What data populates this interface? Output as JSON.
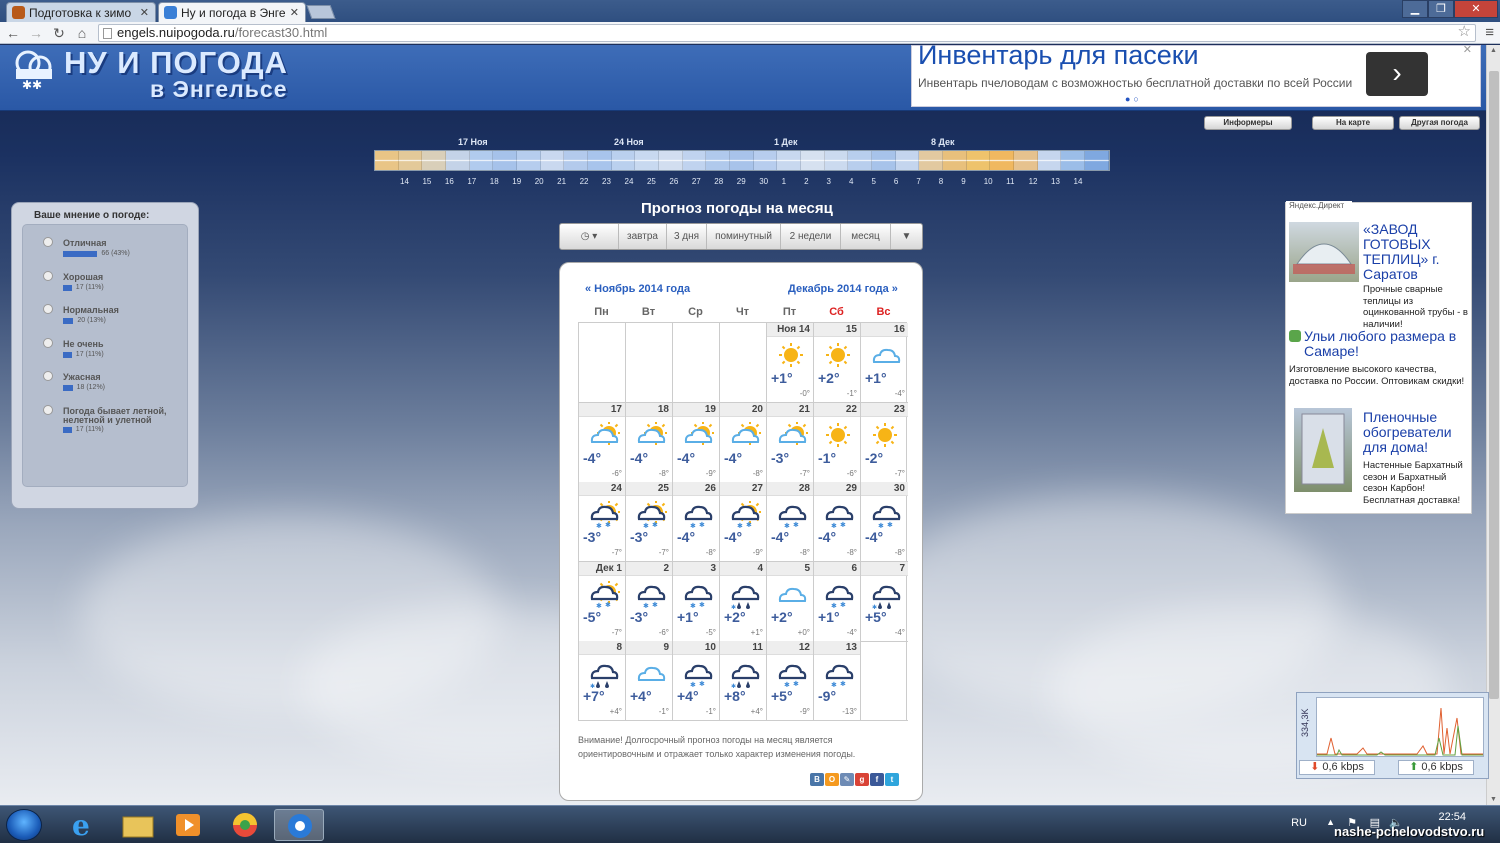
{
  "browser": {
    "tabs": [
      {
        "title": "Подготовка к зимо"
      },
      {
        "title": "Ну и погода в Энге"
      }
    ],
    "url_host": "engels.nuipogoda.ru",
    "url_path": "/forecast30.html"
  },
  "header": {
    "logo_line1": "НУ И ПОГОДА",
    "logo_line2": "в Энгельсе"
  },
  "ad": {
    "title": "Инвентарь для пасеки",
    "subtitle": "Инвентарь пчеловодам с возможностью бесплатной доставки по всей России",
    "dots": "●○"
  },
  "top_buttons": [
    "Информеры",
    "На карте",
    "Другая погода"
  ],
  "timeline": {
    "week_labels": [
      "17 Ноя",
      "24 Ноя",
      "1 Дек",
      "8 Дек"
    ],
    "days": [
      "14",
      "15",
      "16",
      "17",
      "18",
      "19",
      "20",
      "21",
      "22",
      "23",
      "24",
      "25",
      "26",
      "27",
      "28",
      "29",
      "30",
      "1",
      "2",
      "3",
      "4",
      "5",
      "6",
      "7",
      "8",
      "9",
      "10",
      "11",
      "12",
      "13",
      "14"
    ]
  },
  "vote": {
    "title": "Ваше мнение о погоде:",
    "options": [
      {
        "label": "Отличная",
        "count": "66 (43%)",
        "share": 0.43
      },
      {
        "label": "Хорошая",
        "count": "17 (11%)",
        "share": 0.11
      },
      {
        "label": "Нормальная",
        "count": "20 (13%)",
        "share": 0.13
      },
      {
        "label": "Не очень",
        "count": "17 (11%)",
        "share": 0.11
      },
      {
        "label": "Ужасная",
        "count": "18 (12%)",
        "share": 0.12
      },
      {
        "label": "Погода бывает летной, нелетной и улетной",
        "count": "17 (11%)",
        "share": 0.11
      }
    ]
  },
  "forecast": {
    "title": "Прогноз погоды на месяц",
    "tabs": [
      "завтра",
      "3 дня",
      "поминутный",
      "2 недели",
      "месяц"
    ],
    "prev_month": "« Ноябрь 2014 года",
    "next_month": "Декабрь 2014 года »",
    "weekdays": [
      "Пн",
      "Вт",
      "Ср",
      "Чт",
      "Пт",
      "Сб",
      "Вс"
    ],
    "weeks": [
      [
        null,
        null,
        null,
        null,
        {
          "day": "Ноя 14",
          "icon": "sun",
          "t": "+1°",
          "n": "-0°"
        },
        {
          "day": "15",
          "icon": "sun",
          "t": "+2°",
          "n": "-1°"
        },
        {
          "day": "16",
          "icon": "cloud",
          "t": "+1°",
          "n": "-4°"
        }
      ],
      [
        {
          "day": "17",
          "icon": "sun-cloud",
          "t": "-4°",
          "n": "-6°"
        },
        {
          "day": "18",
          "icon": "sun-cloud",
          "t": "-4°",
          "n": "-8°"
        },
        {
          "day": "19",
          "icon": "sun-cloud",
          "t": "-4°",
          "n": "-9°"
        },
        {
          "day": "20",
          "icon": "sun-cloud",
          "t": "-4°",
          "n": "-8°"
        },
        {
          "day": "21",
          "icon": "sun-cloud",
          "t": "-3°",
          "n": "-7°"
        },
        {
          "day": "22",
          "icon": "sun",
          "t": "-1°",
          "n": "-6°"
        },
        {
          "day": "23",
          "icon": "sun",
          "t": "-2°",
          "n": "-7°"
        }
      ],
      [
        {
          "day": "24",
          "icon": "sun-snow",
          "t": "-3°",
          "n": "-7°"
        },
        {
          "day": "25",
          "icon": "sun-snow",
          "t": "-3°",
          "n": "-7°"
        },
        {
          "day": "26",
          "icon": "snow",
          "t": "-4°",
          "n": "-8°"
        },
        {
          "day": "27",
          "icon": "sun-snow",
          "t": "-4°",
          "n": "-9°"
        },
        {
          "day": "28",
          "icon": "snow",
          "t": "-4°",
          "n": "-8°"
        },
        {
          "day": "29",
          "icon": "snow",
          "t": "-4°",
          "n": "-8°"
        },
        {
          "day": "30",
          "icon": "snow",
          "t": "-4°",
          "n": "-8°"
        }
      ],
      [
        {
          "day": "Дек 1",
          "icon": "sun-snow",
          "t": "-5°",
          "n": "-7°"
        },
        {
          "day": "2",
          "icon": "snow",
          "t": "-3°",
          "n": "-6°"
        },
        {
          "day": "3",
          "icon": "snow",
          "t": "+1°",
          "n": "-5°"
        },
        {
          "day": "4",
          "icon": "rain-snow",
          "t": "+2°",
          "n": "+1°"
        },
        {
          "day": "5",
          "icon": "cloud",
          "t": "+2°",
          "n": "+0°"
        },
        {
          "day": "6",
          "icon": "snow",
          "t": "+1°",
          "n": "-4°"
        },
        {
          "day": "7",
          "icon": "rain-snow",
          "t": "+5°",
          "n": "-4°"
        }
      ],
      [
        {
          "day": "8",
          "icon": "rain-snow",
          "t": "+7°",
          "n": "+4°"
        },
        {
          "day": "9",
          "icon": "cloud",
          "t": "+4°",
          "n": "-1°"
        },
        {
          "day": "10",
          "icon": "snow",
          "t": "+4°",
          "n": "-1°"
        },
        {
          "day": "11",
          "icon": "rain-snow",
          "t": "+8°",
          "n": "+4°"
        },
        {
          "day": "12",
          "icon": "snow",
          "t": "+5°",
          "n": "-9°"
        },
        {
          "day": "13",
          "icon": "snow",
          "t": "-9°",
          "n": "-13°"
        },
        null
      ]
    ],
    "warning": "Внимание! Долгосрочный прогноз погоды на месяц является ориентировочным и отражает только характер изменения погоды."
  },
  "direct": {
    "label": "Яндекс.Директ",
    "ads": [
      {
        "title": "«ЗАВОД ГОТОВЫХ ТЕПЛИЦ» г. Саратов",
        "text": "Прочные сварные теплицы из оцинкованной трубы - в наличии!"
      },
      {
        "title": "Ульи любого размера в Самаре!",
        "text": "Изготовление высокого качества, доставка по России. Оптовикам скидки!"
      },
      {
        "title": "Пленочные обогреватели для дома!",
        "text": "Настенные Бархатный сезон и Бархатный сезон Карбон! Бесплатная доставка!"
      }
    ]
  },
  "netmon": {
    "side": "334,3K",
    "down": "0,6 kbps",
    "up": "0,6 kbps"
  },
  "taskbar": {
    "lang": "RU",
    "time": "22:54",
    "watermark": "nashe-pchelovodstvo.ru"
  }
}
